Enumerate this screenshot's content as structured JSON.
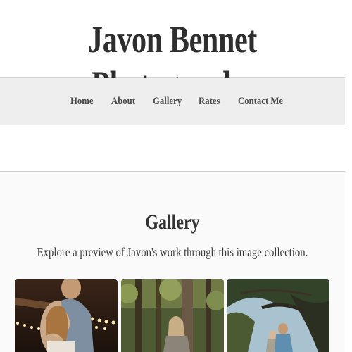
{
  "site": {
    "title": "Javon Bennet Photography"
  },
  "nav": {
    "items": [
      {
        "label": "Home"
      },
      {
        "label": "About"
      },
      {
        "label": "Gallery"
      },
      {
        "label": "Rates"
      },
      {
        "label": "Contact Me"
      }
    ]
  },
  "gallery": {
    "heading": "Gallery",
    "description": "Explore a preview of Javon's work through this image collection.",
    "photos": [
      {
        "subject": "couple-with-string-lights"
      },
      {
        "subject": "woman-in-forest"
      },
      {
        "subject": "couple-under-oak-trees"
      }
    ]
  },
  "colors": {
    "header_bg": "#ffffff",
    "nav_bg": "#eeeeee",
    "page_bg": "#fafafa",
    "text": "#333333"
  }
}
